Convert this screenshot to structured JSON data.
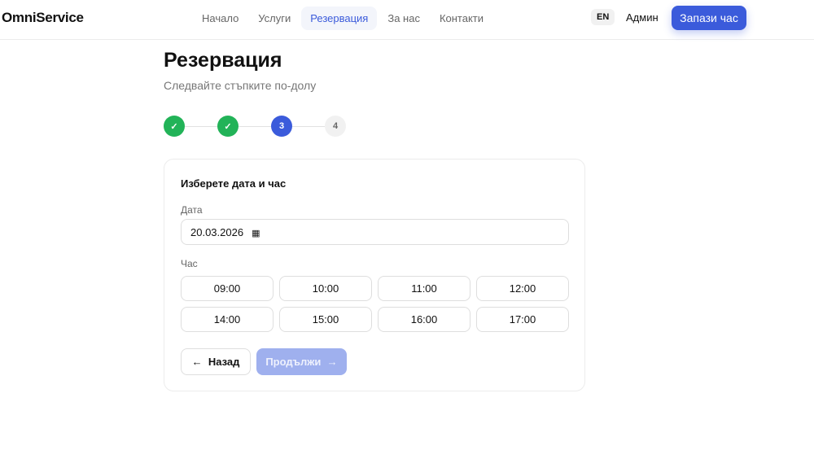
{
  "header": {
    "logo": "OmniService",
    "nav": [
      "Начало",
      "Услуги",
      "Резервация",
      "За нас",
      "Контакти"
    ],
    "lang": "EN",
    "admin": "Админ",
    "cta": "Запази час"
  },
  "page": {
    "title": "Резервация",
    "subtitle": "Следвайте стъпките по-долу"
  },
  "steps": [
    {
      "label": "✓",
      "state": "done"
    },
    {
      "label": "✓",
      "state": "done"
    },
    {
      "label": "3",
      "state": "current"
    },
    {
      "label": "4",
      "state": "todo"
    }
  ],
  "form": {
    "title": "Изберете дата и час",
    "date_label": "Дата",
    "date_value": "20.03.2026",
    "time_label": "Час",
    "times": [
      "09:00",
      "10:00",
      "11:00",
      "12:00",
      "14:00",
      "15:00",
      "16:00",
      "17:00"
    ],
    "back": "Назад",
    "next": "Продължи"
  }
}
